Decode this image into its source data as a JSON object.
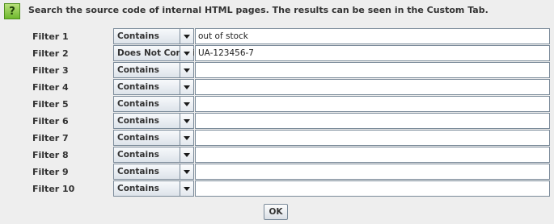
{
  "header": {
    "help_label": "?",
    "description": "Search the source code of internal HTML pages. The results can be seen in the Custom Tab."
  },
  "filters": [
    {
      "label": "Filter 1",
      "condition": "Contains",
      "value": "out of stock"
    },
    {
      "label": "Filter 2",
      "condition": "Does Not Contain",
      "value": "UA-123456-7"
    },
    {
      "label": "Filter 3",
      "condition": "Contains",
      "value": ""
    },
    {
      "label": "Filter 4",
      "condition": "Contains",
      "value": ""
    },
    {
      "label": "Filter 5",
      "condition": "Contains",
      "value": ""
    },
    {
      "label": "Filter 6",
      "condition": "Contains",
      "value": ""
    },
    {
      "label": "Filter 7",
      "condition": "Contains",
      "value": ""
    },
    {
      "label": "Filter 8",
      "condition": "Contains",
      "value": ""
    },
    {
      "label": "Filter 9",
      "condition": "Contains",
      "value": ""
    },
    {
      "label": "Filter 10",
      "condition": "Contains",
      "value": ""
    }
  ],
  "footer": {
    "ok_label": "OK"
  },
  "icons": {
    "help": "help-icon",
    "dropdown": "chevron-down-icon"
  },
  "colors": {
    "help_green": "#6fb82e",
    "background": "#eeeeee",
    "border": "#7a8a99"
  }
}
